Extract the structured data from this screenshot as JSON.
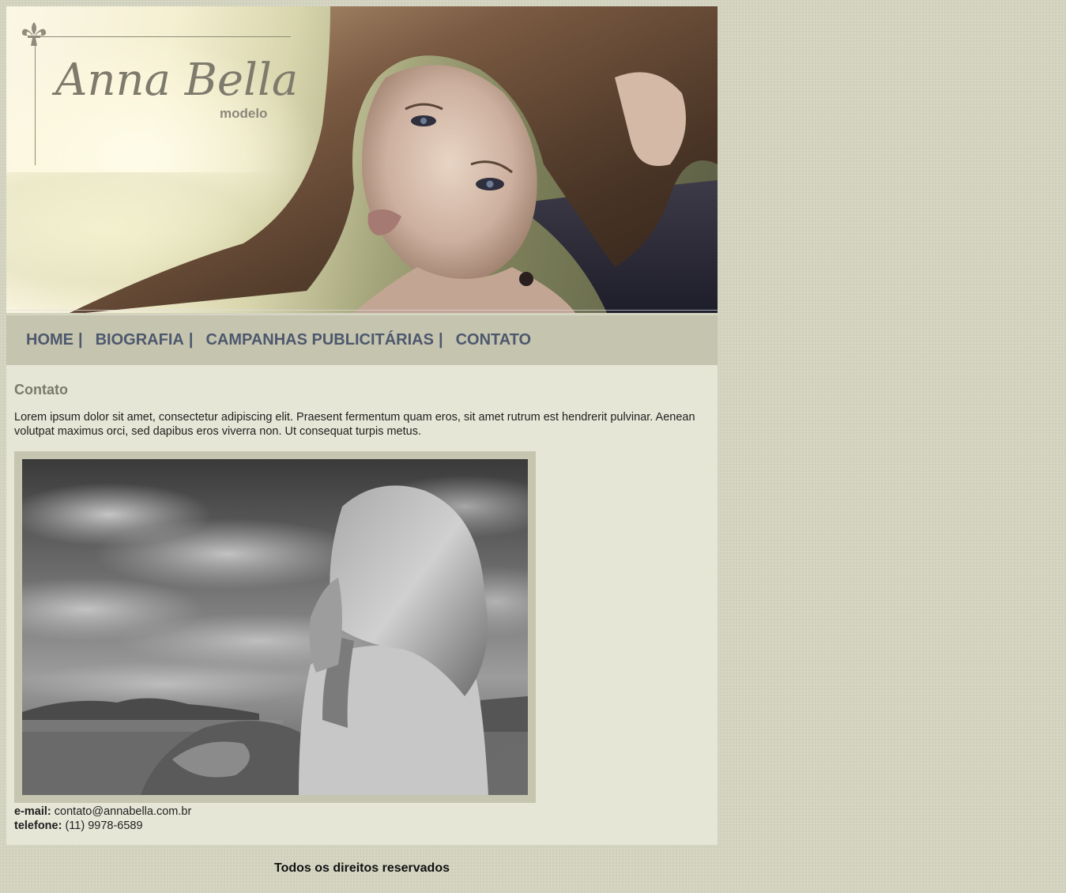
{
  "banner": {
    "brand_name": "Anna Bella",
    "brand_subtitle": "modelo",
    "logo_icon": "fleur-de-lis-icon"
  },
  "nav": {
    "items": [
      {
        "label": "HOME"
      },
      {
        "label": "BIOGRAFIA"
      },
      {
        "label": "CAMPANHAS PUBLICITÁRIAS"
      },
      {
        "label": "CONTATO"
      }
    ],
    "separator": "|"
  },
  "content": {
    "title": "Contato",
    "lead": "Lorem ipsum dolor sit amet, consectetur adipiscing elit. Praesent fermentum quam eros, sit amet rutrum est hendrerit pulvinar. Aenean volutpat maximus orci, sed dapibus eros viverra non. Ut consequat turpis metus.",
    "email_label": "e-mail:",
    "email_value": "contato@annabella.com.br",
    "phone_label": "telefone:",
    "phone_value": "(11) 9978-6589"
  },
  "footer": {
    "text": "Todos os direitos reservados"
  },
  "colors": {
    "page_background": "#d3d3c0",
    "nav_background": "#c5c4ae",
    "nav_text": "#4d586e",
    "content_background": "#e6e6d7",
    "heading": "#7a7a6c"
  }
}
